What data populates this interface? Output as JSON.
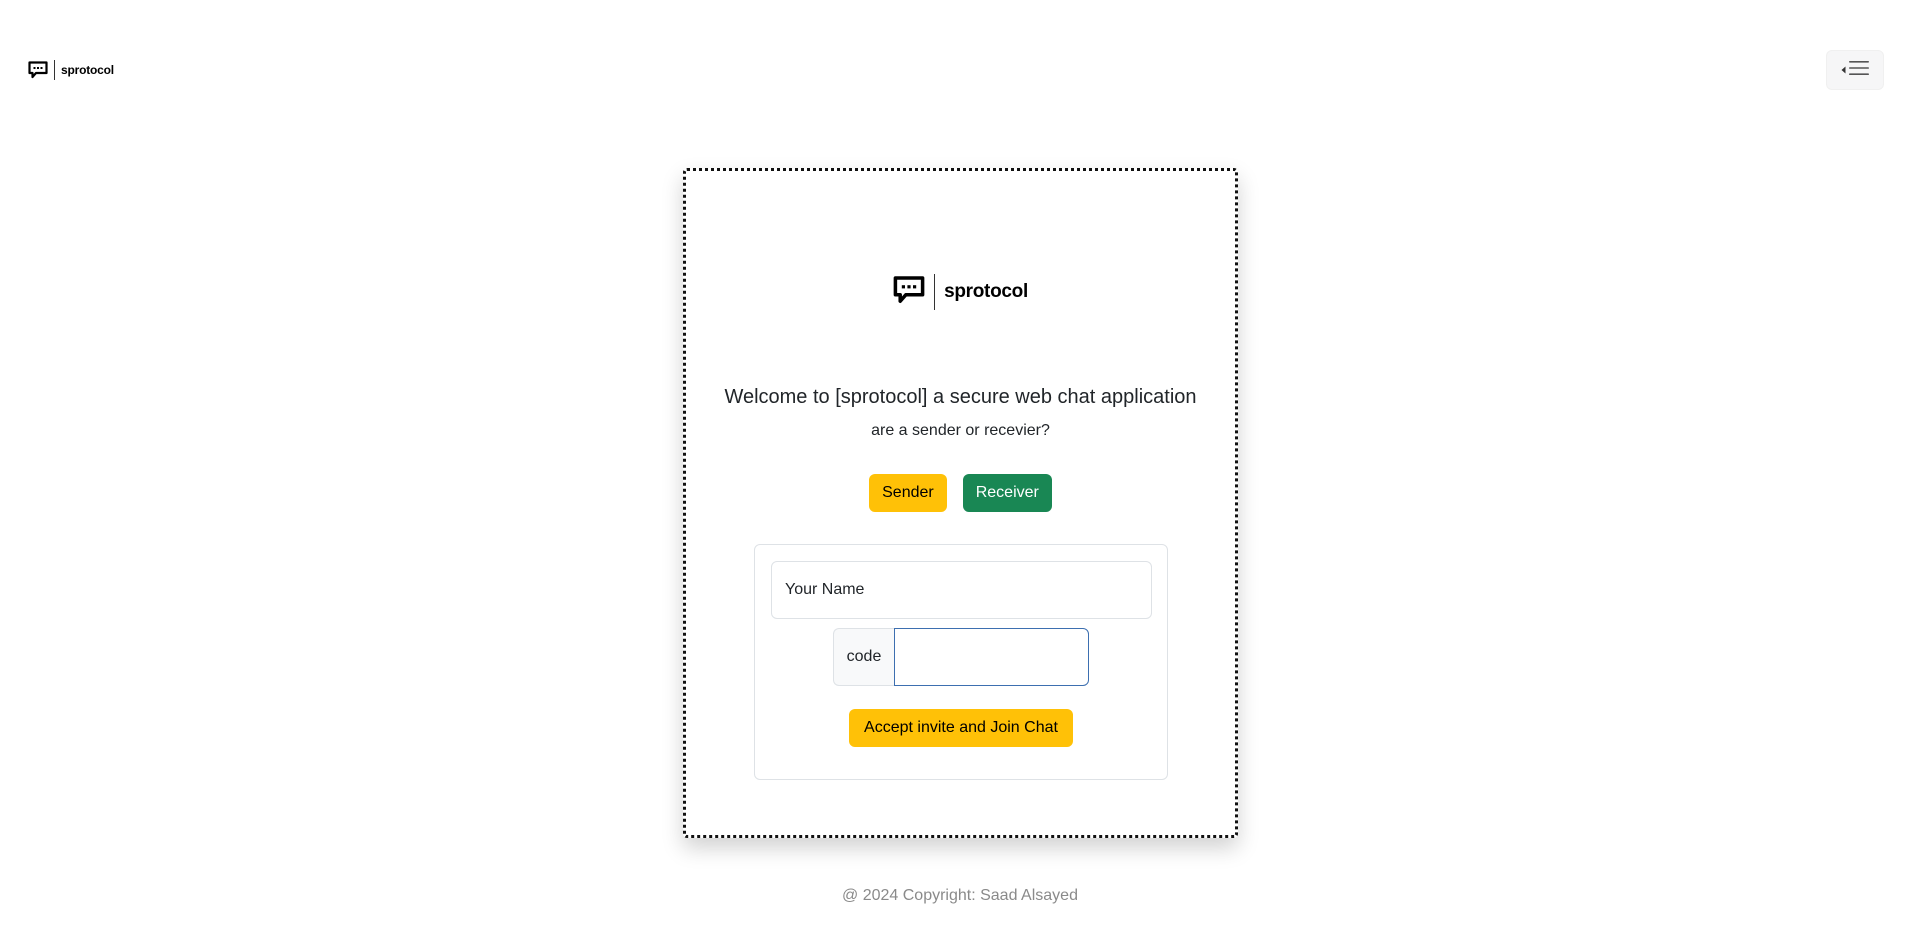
{
  "navbar": {
    "brand": "sprotocol"
  },
  "card": {
    "brand": "sprotocol",
    "welcome": "Welcome to [sprotocol] a secure web chat application",
    "question": "are a sender or recevier?",
    "sender_label": "Sender",
    "receiver_label": "Receiver",
    "name_placeholder": "Your Name",
    "code_label": "code",
    "code_value": "",
    "accept_label": "Accept invite and Join Chat"
  },
  "footer": {
    "copyright": "@ 2024 Copyright: Saad Alsayed"
  },
  "colors": {
    "warning": "#ffc107",
    "success": "#198754",
    "focus_border": "#3d6fb0"
  },
  "icons": {
    "brand_logo": "chat-bubble-icon",
    "menu_toggle": "hamburger-menu-icon"
  }
}
